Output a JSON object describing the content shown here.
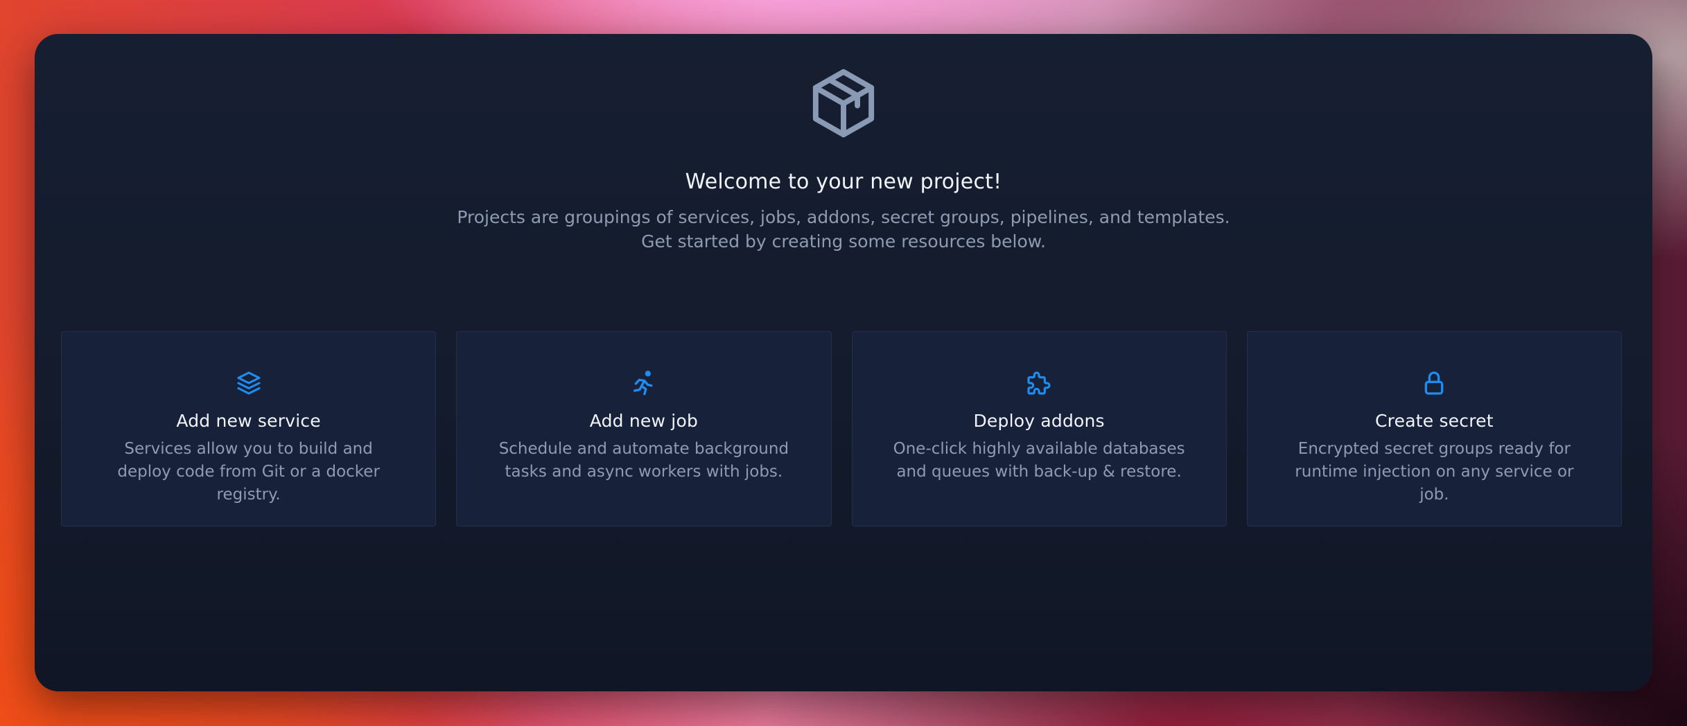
{
  "hero": {
    "icon": "package-box-icon",
    "title": "Welcome to your new project!",
    "description": "Projects are groupings of services, jobs, addons, secret groups, pipelines, and templates. Get started by creating some resources below."
  },
  "cards": [
    {
      "icon": "layers-stack-icon",
      "title": "Add new service",
      "description": "Services allow you to build and deploy code from Git or a docker registry."
    },
    {
      "icon": "running-person-icon",
      "title": "Add new job",
      "description": "Schedule and automate background tasks and async workers with jobs."
    },
    {
      "icon": "puzzle-piece-icon",
      "title": "Deploy addons",
      "description": "One-click highly available databases and queues with back-up & restore."
    },
    {
      "icon": "padlock-icon",
      "title": "Create secret",
      "description": "Encrypted secret groups ready for runtime injection on any service or job."
    }
  ],
  "colors": {
    "accent": "#1f8df0",
    "hero_icon": "#8a9ab4",
    "card_bg": "#172139",
    "window_bg": "#141c2e"
  }
}
